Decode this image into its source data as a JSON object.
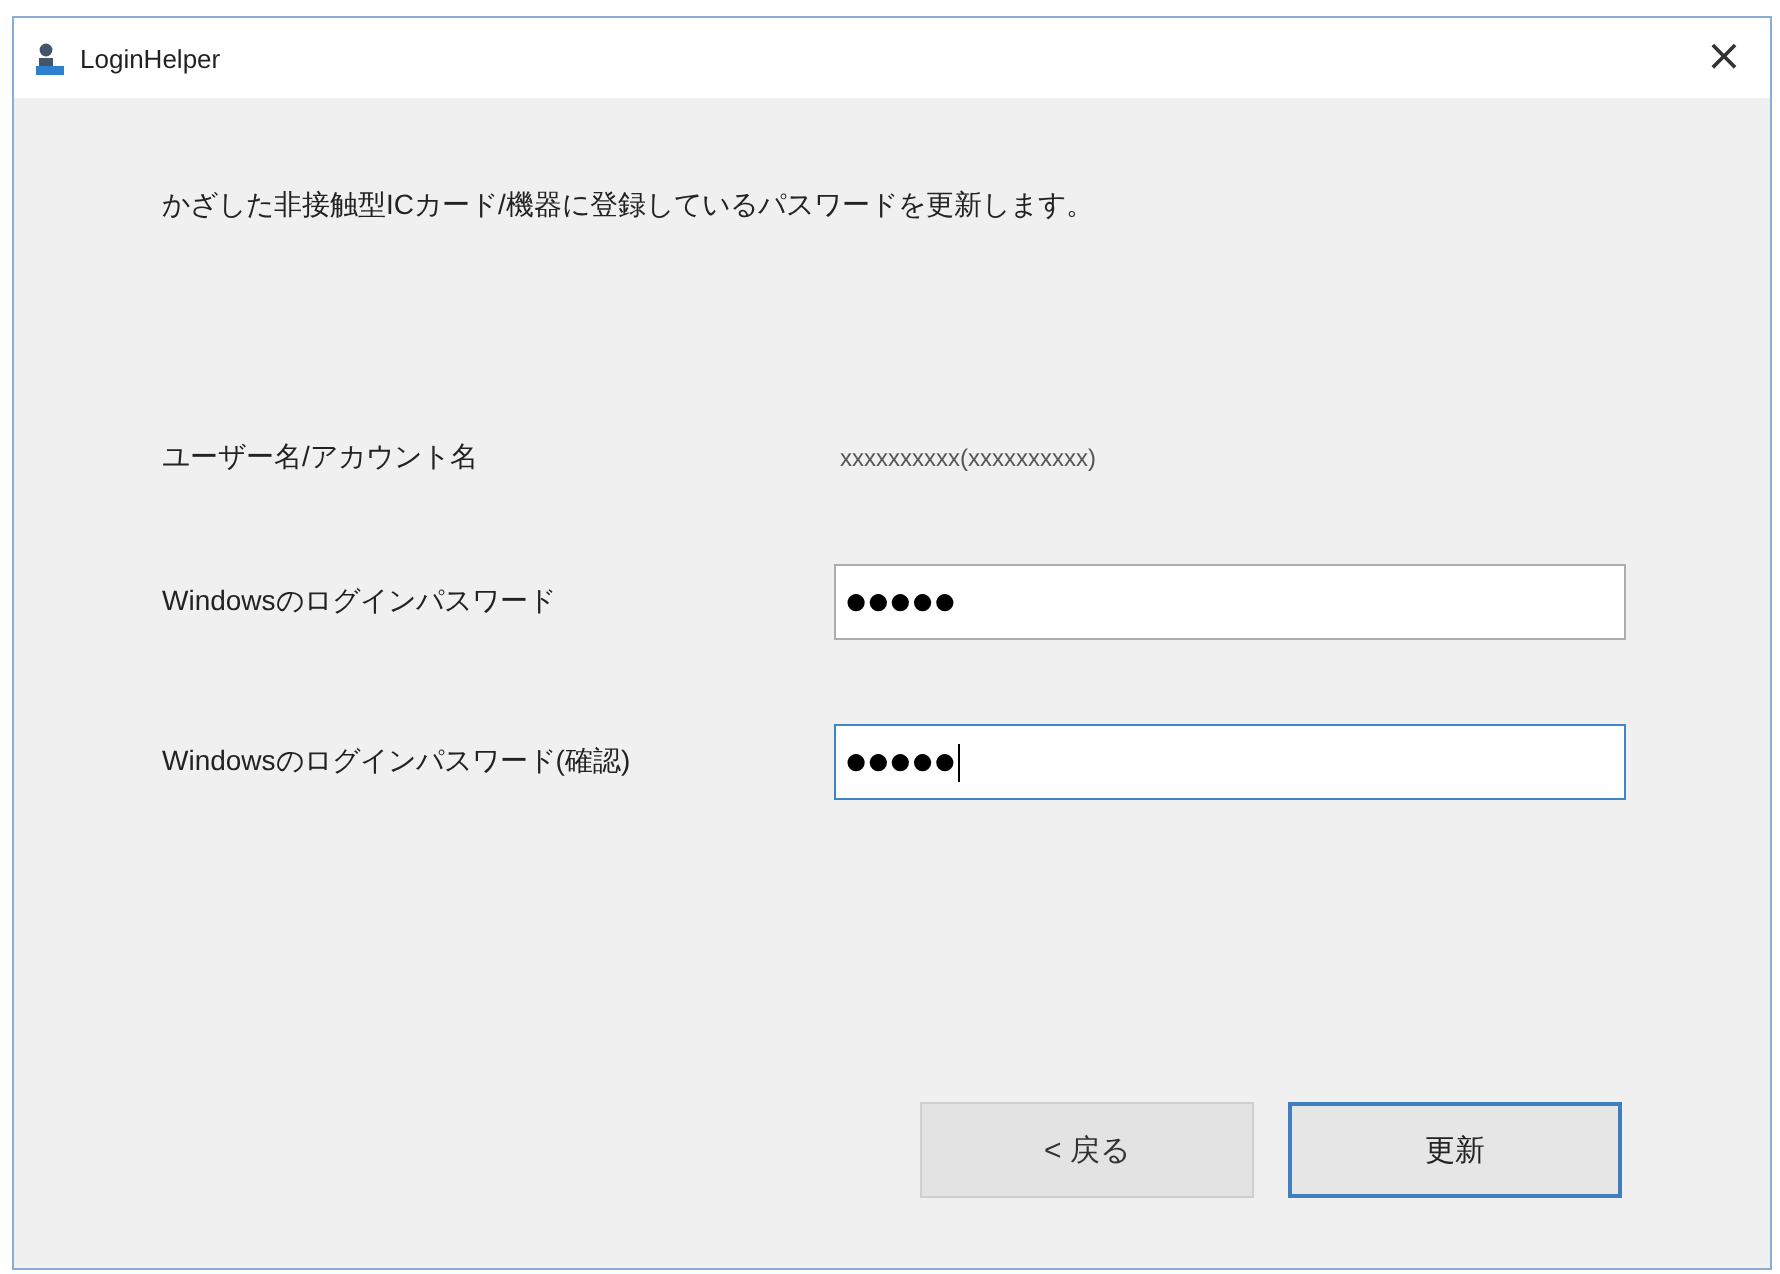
{
  "window": {
    "title": "LoginHelper",
    "close": "×"
  },
  "message": "かざした非接触型ICカード/機器に登録しているパスワードを更新します。",
  "fields": [
    {
      "label": "ユーザー名/アカウント名",
      "kind": "text",
      "value": "xxxxxxxxxx(xxxxxxxxxx)"
    },
    {
      "label": "Windowsのログインパスワード",
      "kind": "input",
      "value": "●●●●●",
      "focused": false
    },
    {
      "label": "Windowsのログインパスワード(確認)",
      "kind": "input",
      "value": "●●●●●",
      "focused": true
    }
  ],
  "buttons": [
    {
      "label": "< 戻る",
      "default": false
    },
    {
      "label": "更新",
      "default": true
    }
  ]
}
